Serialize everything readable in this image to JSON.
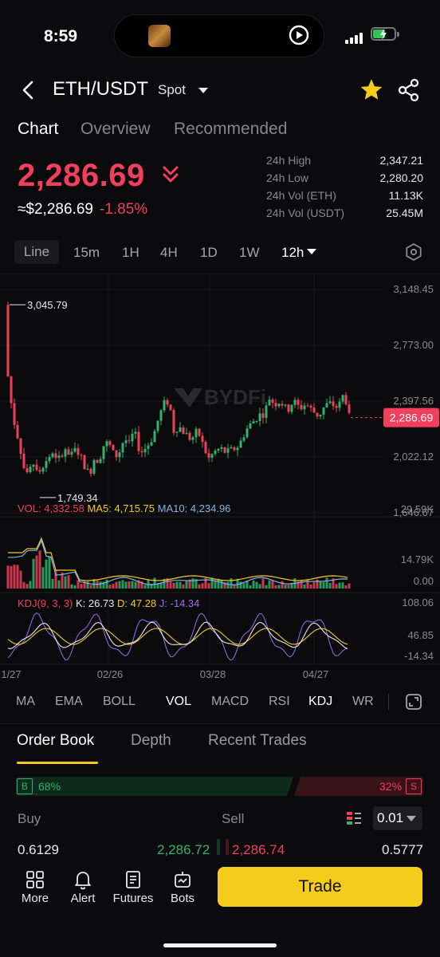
{
  "status": {
    "time": "8:59"
  },
  "header": {
    "pair": "ETH/USDT",
    "market": "Spot"
  },
  "tabs": [
    "Chart",
    "Overview",
    "Recommended"
  ],
  "ticker": {
    "price": "2,286.69",
    "approx": "≈$2,286.69",
    "change": "-1.85%",
    "stats": [
      {
        "label": "24h High",
        "value": "2,347.21"
      },
      {
        "label": "24h Low",
        "value": "2,280.20"
      },
      {
        "label": "24h Vol (ETH)",
        "value": "11.13K"
      },
      {
        "label": "24h Vol (USDT)",
        "value": "25.45M"
      }
    ]
  },
  "timeframes": [
    "Line",
    "15m",
    "1H",
    "4H",
    "1D",
    "1W",
    "12h"
  ],
  "chart": {
    "watermark": "BYDFi",
    "price_axis": [
      "3,148.45",
      "2,773.00",
      "2,397.56",
      "2,022.12",
      "1,646.67"
    ],
    "current_price_tag": "2,286.69",
    "high_marker": "3,045.79",
    "low_marker": "1,749.34",
    "vol_legend": {
      "vol": "VOL: 4,332.58",
      "ma5": "MA5: 4,715.75",
      "ma10": "MA10: 4,234.96"
    },
    "vol_axis": [
      "29.59K",
      "14.79K",
      "0.00"
    ],
    "kdj_legend": {
      "name": "KDJ(9, 3, 3)",
      "k": "K: 26.73",
      "d": "D: 47.28",
      "j": "J: -14.34"
    },
    "kdj_axis": [
      "108.06",
      "46.85",
      "-14.34"
    ],
    "dates": [
      "1/27",
      "02/26",
      "03/28",
      "04/27"
    ],
    "colors": {
      "up": "#2fb36d",
      "down": "#f23f5b",
      "ma5": "#f5cc1c",
      "ma10": "#7fb7e6",
      "j": "#9b6cf0"
    }
  },
  "indicators": [
    "MA",
    "EMA",
    "BOLL",
    "VOL",
    "MACD",
    "RSI",
    "KDJ",
    "WR"
  ],
  "orderbook": {
    "tabs": [
      "Order Book",
      "Depth",
      "Recent Trades"
    ],
    "buy_pct": "68%",
    "sell_pct": "32%",
    "buy_tag": "B",
    "sell_tag": "S",
    "col_buy": "Buy",
    "col_sell": "Sell",
    "precision": "0.01",
    "row": {
      "buy_amount": "0.6129",
      "buy_price": "2,286.72",
      "sell_price": "2,286.74",
      "sell_amount": "0.5777"
    }
  },
  "bottom_nav": {
    "items": [
      "More",
      "Alert",
      "Futures",
      "Bots"
    ],
    "trade": "Trade"
  }
}
